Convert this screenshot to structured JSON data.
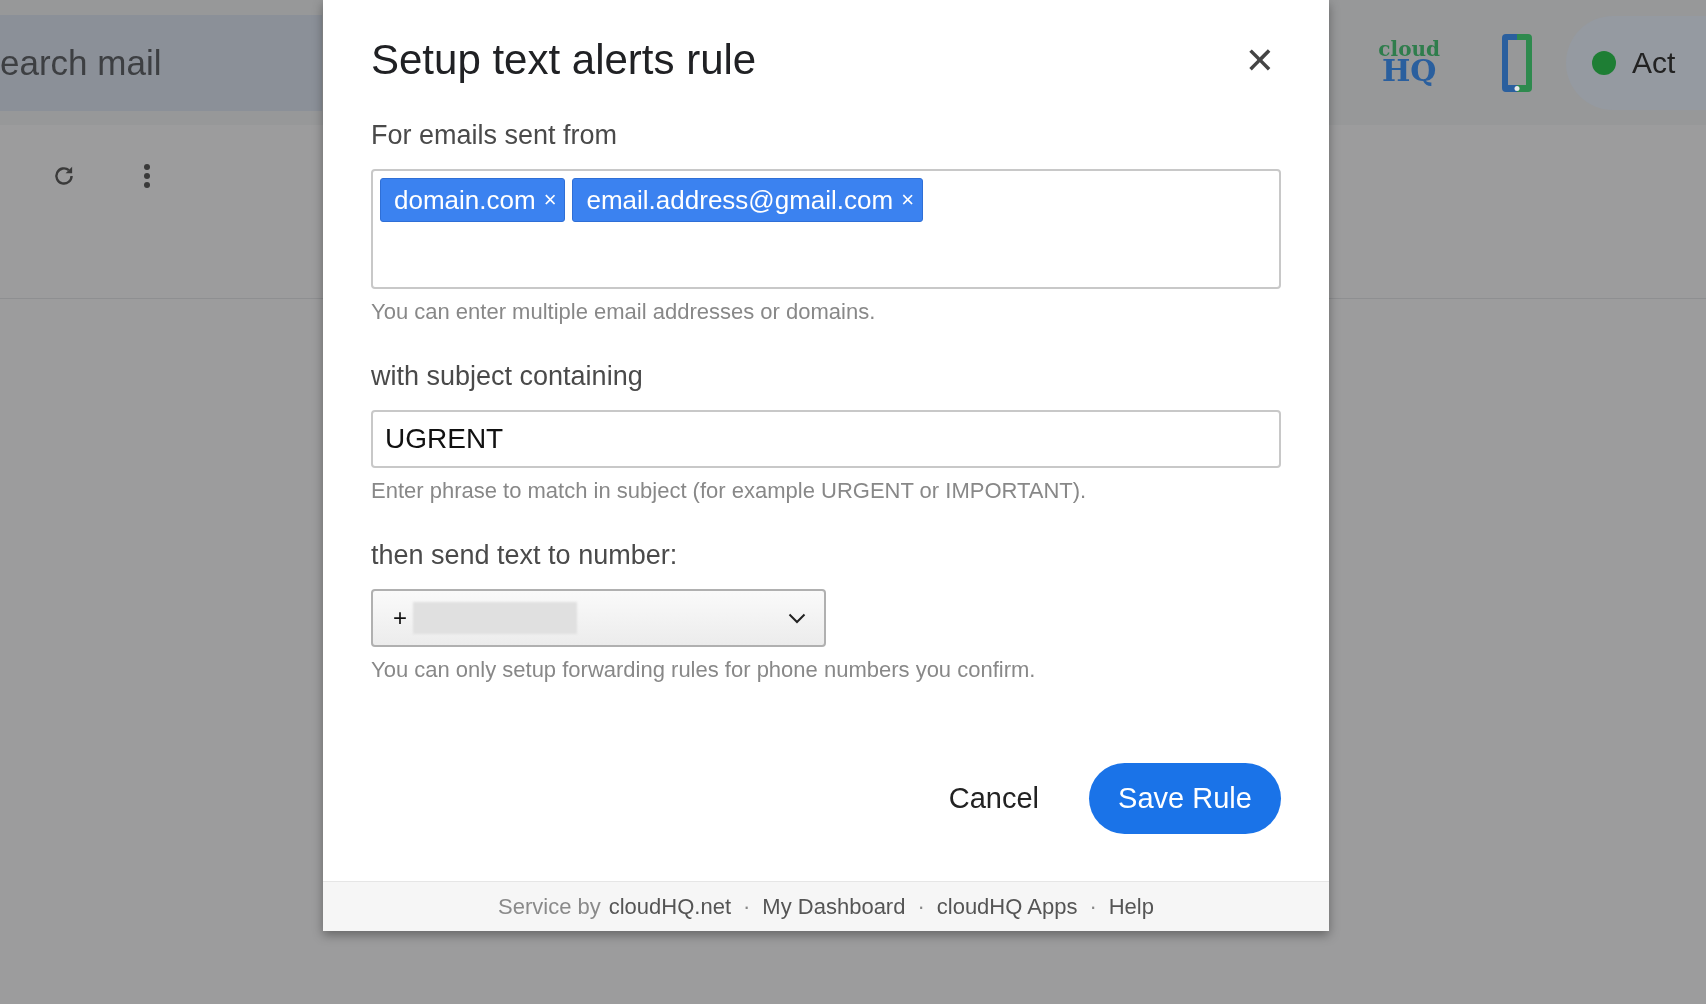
{
  "background": {
    "search": {
      "placeholder": "earch mail"
    },
    "logo": {
      "line1": "cloud",
      "line2": "HQ"
    },
    "status": {
      "label": "Act",
      "color": "#1e7e34"
    }
  },
  "dialog": {
    "title": "Setup text alerts rule",
    "close": "✕",
    "from": {
      "label": "For emails sent from",
      "tags": [
        {
          "label": "domain.com",
          "remove": "×"
        },
        {
          "label": "email.address@gmail.com",
          "remove": "×"
        }
      ],
      "help": "You can enter multiple email addresses or domains."
    },
    "subject": {
      "label": "with subject containing",
      "value": "UGRENT",
      "help": "Enter phrase to match in subject (for example URGENT or IMPORTANT)."
    },
    "number": {
      "label": "then send text to number:",
      "value": "+",
      "redacted": true,
      "help": "You can only setup forwarding rules for phone numbers you confirm."
    },
    "buttons": [
      {
        "label": "Cancel",
        "kind": "secondary"
      },
      {
        "label": "Save Rule",
        "kind": "primary"
      }
    ],
    "footer": [
      {
        "kind": "text",
        "text": "Service by"
      },
      {
        "kind": "link",
        "text": "cloudHQ.net"
      },
      {
        "kind": "separator",
        "text": "·"
      },
      {
        "kind": "link",
        "text": "My Dashboard"
      },
      {
        "kind": "separator",
        "text": "·"
      },
      {
        "kind": "link",
        "text": "cloudHQ Apps"
      },
      {
        "kind": "separator",
        "text": "·"
      },
      {
        "kind": "link",
        "text": "Help"
      }
    ]
  }
}
